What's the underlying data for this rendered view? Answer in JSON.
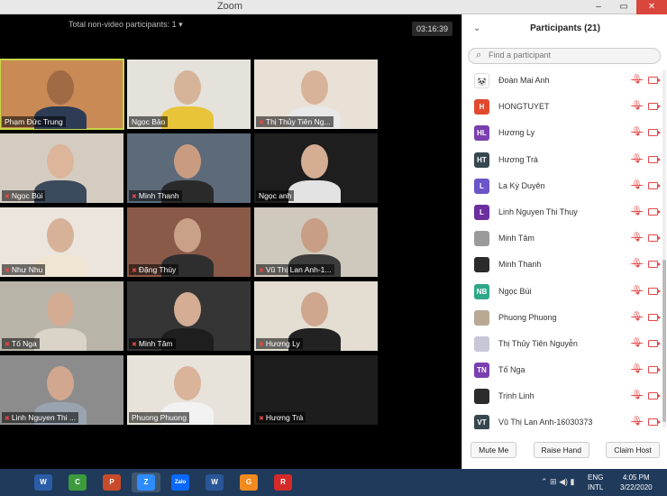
{
  "window": {
    "title": "Zoom",
    "minimize": "–",
    "maximize": "▭",
    "close": "✕"
  },
  "gallery": {
    "header": "Total non-video participants: 1",
    "header_caret": "▾",
    "timer": "03:16:39",
    "tiles": [
      {
        "name": "Phạm Đức Trung",
        "muted": false,
        "active": true,
        "bg": "#c98a55",
        "face": "#a06a45",
        "shirt": "#2d3b55"
      },
      {
        "name": "Ngọc Bảo",
        "muted": false,
        "active": false,
        "bg": "#e5e2dc",
        "face": "#d6b49a",
        "shirt": "#e8c43a"
      },
      {
        "name": "Thị Thủy Tiên Ng...",
        "muted": true,
        "active": false,
        "bg": "#e9e1d6",
        "face": "#d9b29a",
        "shirt": "#e8e8e8"
      },
      {
        "name": "Ngọc Bùi",
        "muted": true,
        "active": false,
        "bg": "#d4ccc1",
        "face": "#dcb59b",
        "shirt": "#3b4a5c"
      },
      {
        "name": "Minh Thanh",
        "muted": true,
        "active": false,
        "bg": "#5c6a7a",
        "face": "#c99c82",
        "shirt": "#2a2a2a"
      },
      {
        "name": "Ngọc anh",
        "muted": false,
        "active": false,
        "bg": "#1e1e1e",
        "face": "#d5ad93",
        "shirt": "#e3e3e3"
      },
      {
        "name": "Như Nhu",
        "muted": true,
        "active": false,
        "bg": "#ebe5dd",
        "face": "#d8b199",
        "shirt": "#f0e5d2"
      },
      {
        "name": "Đặng Thùy",
        "muted": true,
        "active": false,
        "bg": "#8a5a48",
        "face": "#c9a088",
        "shirt": "#2e2e2e"
      },
      {
        "name": "Vũ Thị Lan Anh-1...",
        "muted": true,
        "active": false,
        "bg": "#cfc8bc",
        "face": "#c99e86",
        "shirt": "#3c3c3c"
      },
      {
        "name": "Tố Nga",
        "muted": true,
        "active": false,
        "bg": "#b8b4a8",
        "face": "#d3ab92",
        "shirt": "#d9d3c8"
      },
      {
        "name": "Minh Tâm",
        "muted": true,
        "active": false,
        "bg": "#353535",
        "face": "#d4ad94",
        "shirt": "#1e1e1e"
      },
      {
        "name": "Hương Ly",
        "muted": true,
        "active": false,
        "bg": "#e3ddd2",
        "face": "#cfa68e",
        "shirt": "#222222"
      },
      {
        "name": "Linh Nguyen Thi ...",
        "muted": true,
        "active": false,
        "bg": "#8c8c8c",
        "face": "#d1a88f",
        "shirt": "#9aa4b0"
      },
      {
        "name": "Phuong Phuong",
        "muted": false,
        "active": false,
        "bg": "#e8e3da",
        "face": "#d9b39a",
        "shirt": "#f2f2f2"
      },
      {
        "name": "Hương Trà",
        "muted": true,
        "active": false,
        "bg": "#1d1d1d",
        "face": "",
        "shirt": ""
      }
    ]
  },
  "panel": {
    "title": "Participants (21)",
    "collapse_icon": "⌄",
    "search_placeholder": "Find a participant",
    "search_icon": "⌕",
    "mic_icon": "🎙",
    "participants": [
      {
        "name": "Đoàn Mai Anh",
        "initials": "🐼",
        "color": "#ffffff"
      },
      {
        "name": "HONGTUYET",
        "initials": "H",
        "color": "#e04a2f"
      },
      {
        "name": "Hương Ly",
        "initials": "HL",
        "color": "#7a3fb0"
      },
      {
        "name": "Hương Trà",
        "initials": "HT",
        "color": "#36474f"
      },
      {
        "name": "La Kỳ Duyên",
        "initials": "L",
        "color": "#6c54c9"
      },
      {
        "name": "Linh Nguyen Thi Thuy",
        "initials": "L",
        "color": "#6b2fa0"
      },
      {
        "name": "Minh Tâm",
        "initials": "",
        "color": "#9a9a9a"
      },
      {
        "name": "Minh Thanh",
        "initials": "",
        "color": "#2b2b2b"
      },
      {
        "name": "Ngọc Bùi",
        "initials": "NB",
        "color": "#2ea88a"
      },
      {
        "name": "Phuong Phuong",
        "initials": "",
        "color": "#b9a894"
      },
      {
        "name": "Thị Thủy Tiên Nguyễn",
        "initials": "",
        "color": "#c7c7d8"
      },
      {
        "name": "Tố Nga",
        "initials": "TN",
        "color": "#7a3fb0"
      },
      {
        "name": "Trịnh Linh",
        "initials": "",
        "color": "#2b2b2b"
      },
      {
        "name": "Vũ Thị Lan Anh-16030373",
        "initials": "VT",
        "color": "#36474f"
      }
    ],
    "buttons": {
      "mute": "Mute Me",
      "raise": "Raise Hand",
      "claim": "Claim Host"
    }
  },
  "taskbar": {
    "apps": [
      {
        "label": "W",
        "color": "#2b5ca8"
      },
      {
        "label": "C",
        "color": "#3c9a3c"
      },
      {
        "label": "P",
        "color": "#c74a2a"
      },
      {
        "label": "Z",
        "color": "#2d8cff"
      },
      {
        "label": "Zalo",
        "color": "#0a68fe"
      },
      {
        "label": "W",
        "color": "#2a5699"
      },
      {
        "label": "G",
        "color": "#f28a1e"
      },
      {
        "label": "R",
        "color": "#d42a2a"
      }
    ],
    "tray_icons": "⌃ ⊞ ◀) ▮",
    "lang_top": "ENG",
    "lang_bottom": "INTL",
    "time": "4:05 PM",
    "date": "3/22/2020"
  }
}
